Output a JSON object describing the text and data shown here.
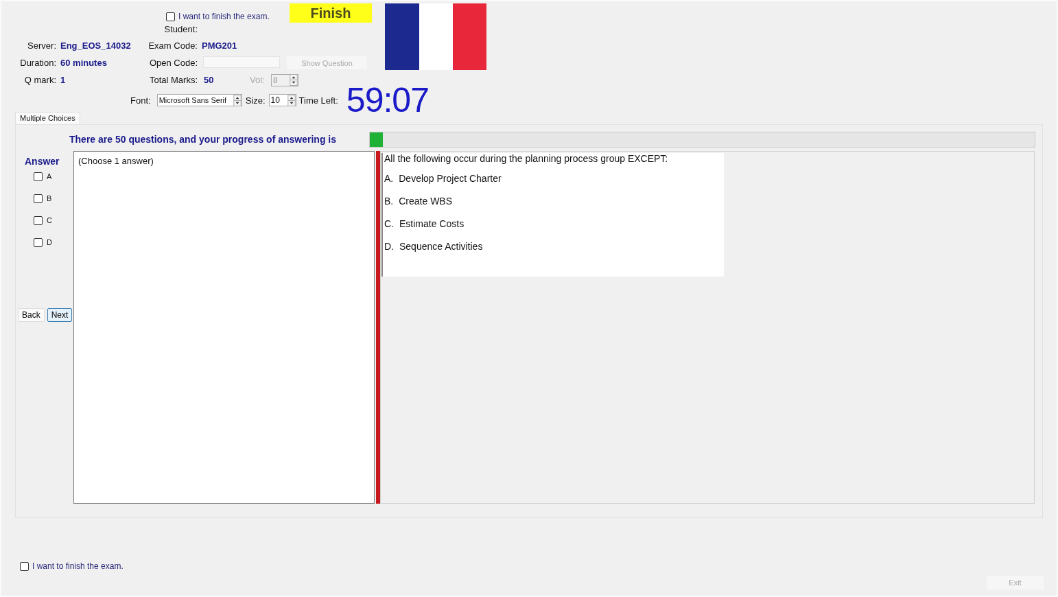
{
  "header": {
    "finish_check": {
      "label": "I want to finish the exam.",
      "checked": false
    },
    "finish_button": "Finish",
    "student": {
      "label": "Student:"
    },
    "server": {
      "label": "Server:",
      "value": "Eng_EOS_14032"
    },
    "exam_code": {
      "label": "Exam Code:",
      "value": "PMG201"
    },
    "duration": {
      "label": "Duration:",
      "value": "60 minutes"
    },
    "open_code": {
      "label": "Open Code:"
    },
    "show_question_button": {
      "label": "Show Question",
      "disabled": true
    },
    "q_mark": {
      "label": "Q mark:",
      "value": "1"
    },
    "total_marks": {
      "label": "Total Marks:",
      "value": "50"
    },
    "vol": {
      "label": "Vol:",
      "value": "8",
      "disabled": true
    },
    "font": {
      "label": "Font:",
      "value": "Microsoft Sans Serif"
    },
    "size": {
      "label": "Size:",
      "value": "10"
    },
    "time_left": {
      "label": "Time Left:",
      "value": "59:07"
    }
  },
  "tabs": [
    {
      "label": "Multiple Choices",
      "selected": true
    }
  ],
  "progress": {
    "text": "There are 50 questions, and your progress of answering is",
    "level": 0.02
  },
  "answer": {
    "title": "Answer",
    "options": [
      {
        "label": "A",
        "checked": false
      },
      {
        "label": "B",
        "checked": false
      },
      {
        "label": "C",
        "checked": false
      },
      {
        "label": "D",
        "checked": false
      }
    ]
  },
  "nav_buttons": [
    {
      "label": "Back",
      "focused": false
    },
    {
      "label": "Next",
      "focused": true
    }
  ],
  "answer_note": "(Choose 1 answer)",
  "question": {
    "text": "All the following occur during the planning process group EXCEPT:",
    "choices": [
      {
        "letter": "A.",
        "text": "Develop Project Charter"
      },
      {
        "letter": "B.",
        "text": "Create WBS"
      },
      {
        "letter": "C.",
        "text": "Estimate Costs"
      },
      {
        "letter": "D.",
        "text": "Sequence Activities"
      }
    ]
  },
  "footer": {
    "finish_check": {
      "label": "I want to finish the exam.",
      "checked": false
    },
    "exit_button": {
      "label": "Exit",
      "disabled": true
    }
  }
}
